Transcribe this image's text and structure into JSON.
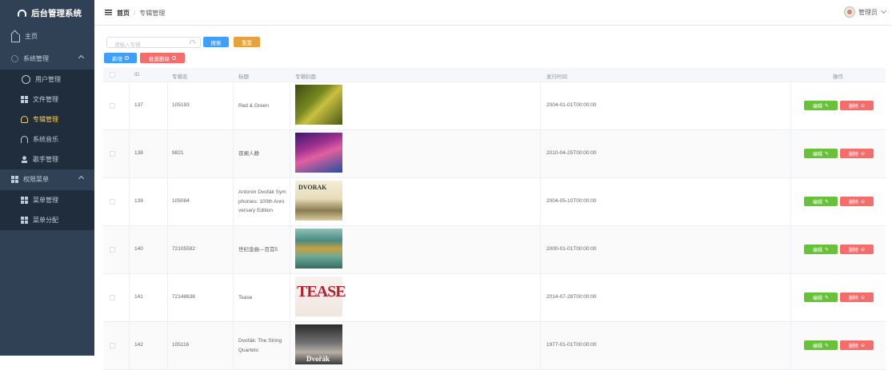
{
  "app": {
    "title": "后台管理系统"
  },
  "sidebar": {
    "items": [
      {
        "label": "主页",
        "icon": "home-icon"
      },
      {
        "label": "系统管理",
        "icon": "gear-icon"
      },
      {
        "label": "用户管理",
        "icon": "user-icon"
      },
      {
        "label": "文件管理",
        "icon": "grid-icon"
      },
      {
        "label": "专辑管理",
        "icon": "award-icon"
      },
      {
        "label": "系统音乐",
        "icon": "headphones-icon"
      },
      {
        "label": "歌手管理",
        "icon": "person-icon"
      },
      {
        "label": "权限菜单",
        "icon": "grid-icon"
      },
      {
        "label": "菜单管理",
        "icon": "grid-icon"
      },
      {
        "label": "菜单分配",
        "icon": "grid-icon"
      }
    ]
  },
  "header": {
    "breadcrumb": {
      "home": "首页",
      "separator": "/",
      "current": "专辑管理"
    },
    "user": "管理员"
  },
  "toolbar": {
    "search_placeholder": "请输入专辑",
    "search_label": "搜索",
    "reset_label": "重置",
    "add_label": "新增",
    "bulk_delete_label": "批量删除"
  },
  "table": {
    "columns": {
      "id": "ID",
      "album_name": "专辑名",
      "title": "标题",
      "cover": "专辑封面",
      "release_time": "发行时间",
      "actions": "操作"
    },
    "edit_label": "编辑",
    "delete_label": "删除",
    "rows": [
      {
        "id": "137",
        "album_name": "105193",
        "title": "Red & Green",
        "release_time": "2004-01-01T00:00:00"
      },
      {
        "id": "138",
        "album_name": "9821",
        "title": "夜阑人静",
        "release_time": "2010-04-25T00:00:00"
      },
      {
        "id": "139",
        "album_name": "105084",
        "title": "Antonín Dvořák Symphonies: 100th Anniversary Edition",
        "release_time": "2004-05-10T00:00:00"
      },
      {
        "id": "140",
        "album_name": "72105592",
        "title": "世纪金曲—百首5",
        "release_time": "2000-01-01T00:00:00"
      },
      {
        "id": "141",
        "album_name": "72148638",
        "title": "Tease",
        "release_time": "2014-07-28T00:00:00"
      },
      {
        "id": "142",
        "album_name": "105116",
        "title": "Dvořák: The String Quartets",
        "release_time": "1977-01-01T00:00:00"
      }
    ]
  },
  "colors": {
    "sidebar_bg": "#304156",
    "active": "#ffd04b",
    "primary": "#409eff",
    "warning": "#e6a23c",
    "danger": "#f56c6c",
    "success": "#67c23a"
  }
}
